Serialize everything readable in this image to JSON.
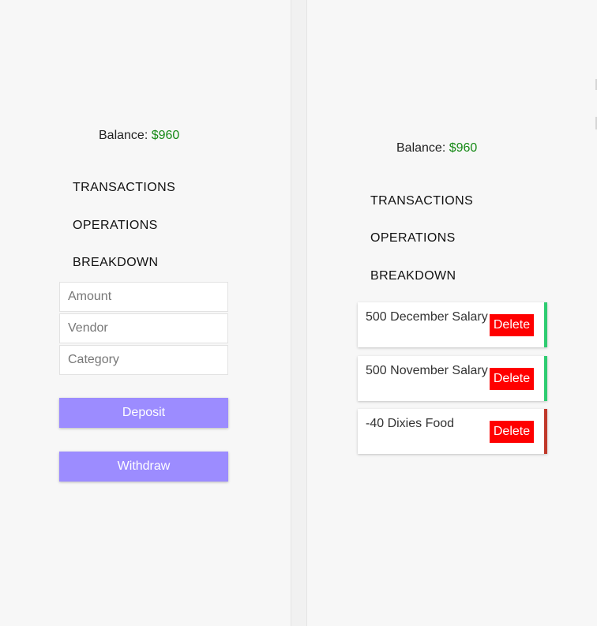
{
  "left_panel": {
    "balance_label": "Balance:",
    "balance_value": "$960",
    "nav": {
      "transactions": "TRANSACTIONS",
      "operations": "OPERATIONS",
      "breakdown": "BREAKDOWN"
    },
    "form": {
      "amount_placeholder": "Amount",
      "vendor_placeholder": "Vendor",
      "category_placeholder": "Category",
      "deposit_label": "Deposit",
      "withdraw_label": "Withdraw"
    }
  },
  "right_panel": {
    "balance_label": "Balance:",
    "balance_value": "$960",
    "nav": {
      "transactions": "TRANSACTIONS",
      "operations": "OPERATIONS",
      "breakdown": "BREAKDOWN"
    },
    "transactions": [
      {
        "text": "500 December Salary",
        "delete_label": "Delete",
        "type": "income"
      },
      {
        "text": "500 November Salary",
        "delete_label": "Delete",
        "type": "income"
      },
      {
        "text": "-40 Dixies Food",
        "delete_label": "Delete",
        "type": "expense"
      }
    ]
  },
  "colors": {
    "balance_positive": "#178a17",
    "button_primary": "#9c8cff",
    "delete_button": "#ff0000",
    "income_border": "#2ecc71",
    "expense_border": "#c0392b"
  }
}
